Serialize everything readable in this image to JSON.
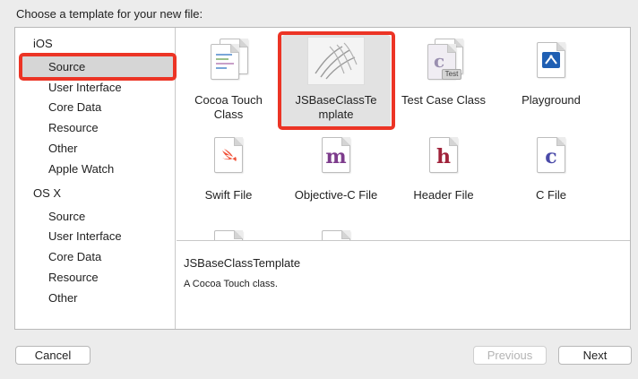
{
  "dialog": {
    "header": "Choose a template for your new file:"
  },
  "sidebar": {
    "groups": [
      {
        "label": "iOS",
        "items": [
          "Source",
          "User Interface",
          "Core Data",
          "Resource",
          "Other",
          "Apple Watch"
        ]
      },
      {
        "label": "OS X",
        "items": [
          "Source",
          "User Interface",
          "Core Data",
          "Resource",
          "Other"
        ]
      }
    ],
    "selected": "iOS / Source"
  },
  "templates": [
    {
      "line1": "Cocoa Touch",
      "line2": "Class",
      "icon": "cocoa-touch-class-icon"
    },
    {
      "line1": "JSBaseClassTe",
      "line2": "mplate",
      "icon": "hands-template-icon",
      "selected": true
    },
    {
      "line1": "Test Case Class",
      "line2": "",
      "icon": "test-case-icon",
      "badge": "Test"
    },
    {
      "line1": "Playground",
      "line2": "",
      "icon": "playground-icon"
    },
    {
      "line1": "Swift File",
      "line2": "",
      "icon": "swift-icon"
    },
    {
      "line1": "Objective-C File",
      "line2": "",
      "icon": "m-file-icon",
      "glyph": "m"
    },
    {
      "line1": "Header File",
      "line2": "",
      "icon": "h-file-icon",
      "glyph": "h"
    },
    {
      "line1": "C File",
      "line2": "",
      "icon": "c-file-icon",
      "glyph": "c"
    }
  ],
  "description": {
    "title": "JSBaseClassTemplate",
    "text": "A Cocoa Touch class."
  },
  "buttons": {
    "cancel": "Cancel",
    "previous": "Previous",
    "next": "Next"
  },
  "colors": {
    "highlight": "#ec3425",
    "selection": "#d6d6d6",
    "swift": "#f05138",
    "objc": "#7d3c8c",
    "header": "#a0223a",
    "c": "#4a4aa8",
    "playground": "#1f5fb3"
  }
}
